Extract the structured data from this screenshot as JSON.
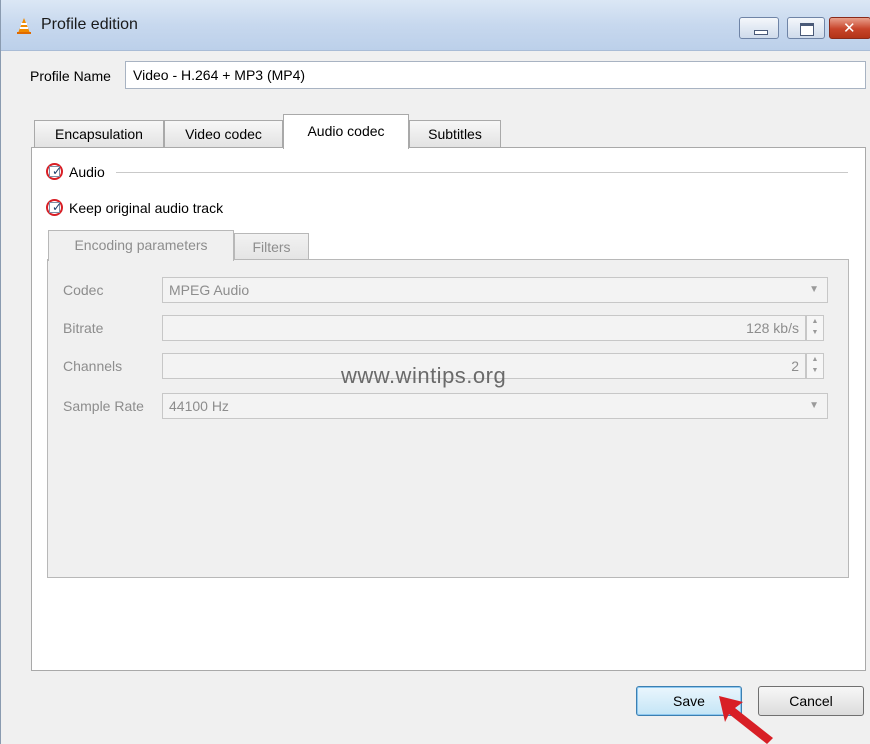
{
  "window": {
    "title": "Profile edition",
    "icon": "vlc-cone-icon",
    "controls": {
      "minimize": "minimize-icon",
      "maximize": "maximize-icon",
      "close": "✕"
    }
  },
  "profile": {
    "label": "Profile Name",
    "value": "Video - H.264 + MP3 (MP4)"
  },
  "tabs": [
    {
      "label": "Encapsulation",
      "active": false
    },
    {
      "label": "Video codec",
      "active": false
    },
    {
      "label": "Audio codec",
      "active": true
    },
    {
      "label": "Subtitles",
      "active": false
    }
  ],
  "audio": {
    "enable_label": "Audio",
    "enable_checked": true,
    "keep_label": "Keep original audio track",
    "keep_checked": true,
    "subtabs": [
      {
        "label": "Encoding parameters",
        "active": true
      },
      {
        "label": "Filters",
        "active": false
      }
    ],
    "fields": {
      "codec_label": "Codec",
      "codec_value": "MPEG Audio",
      "bitrate_label": "Bitrate",
      "bitrate_value": "128 kb/s",
      "channels_label": "Channels",
      "channels_value": "2",
      "samplerate_label": "Sample Rate",
      "samplerate_value": "44100 Hz"
    }
  },
  "watermark": "www.wintips.org",
  "buttons": {
    "save": "Save",
    "cancel": "Cancel"
  },
  "colors": {
    "highlight_circle": "#d81f26",
    "arrow": "#d81f26",
    "titlebar": "#c7d8ee"
  }
}
